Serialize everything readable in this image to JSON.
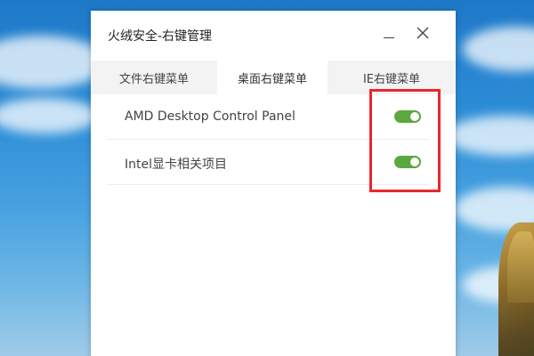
{
  "window": {
    "title": "火绒安全-右键管理"
  },
  "tabs": [
    {
      "label": "文件右键菜单",
      "active": false
    },
    {
      "label": "桌面右键菜单",
      "active": true
    },
    {
      "label": "IE右键菜单",
      "active": false
    }
  ],
  "items": [
    {
      "label": "AMD Desktop Control Panel",
      "enabled": true
    },
    {
      "label": "Intel显卡相关项目",
      "enabled": true
    }
  ],
  "colors": {
    "toggle_on": "#5aa83f",
    "highlight": "#e8282e",
    "tabbar_bg": "#f3f3f3"
  }
}
